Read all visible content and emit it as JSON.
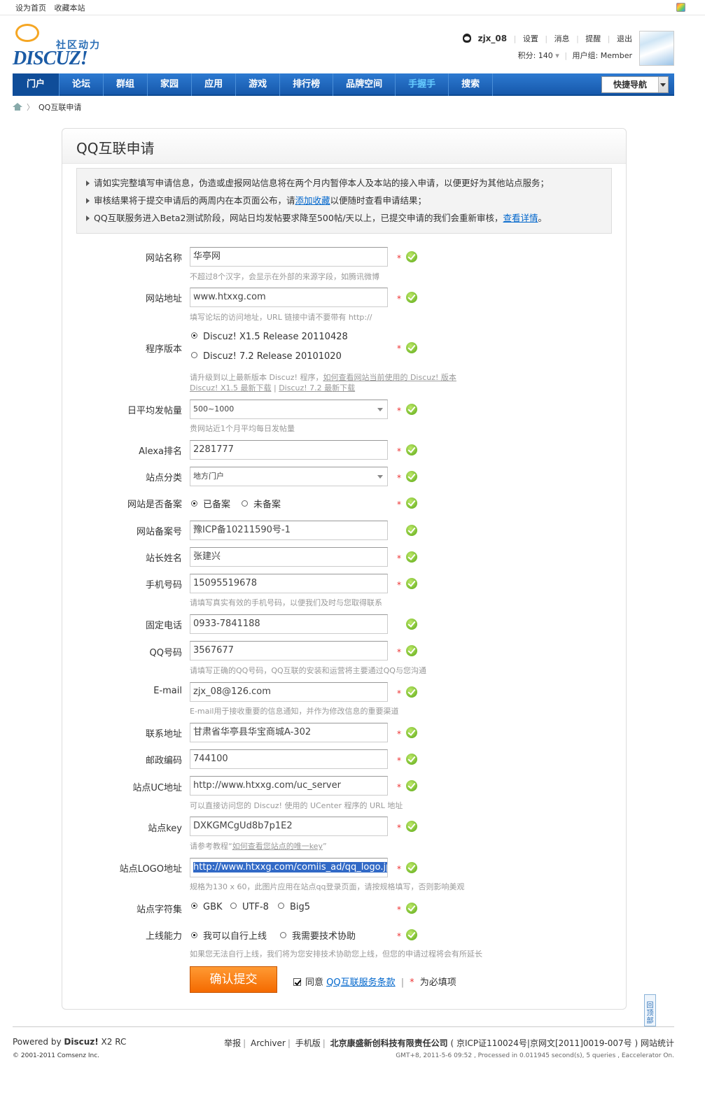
{
  "topbar": {
    "set_home": "设为首页",
    "bookmark": "收藏本站"
  },
  "logo": {
    "tagline": "社区动力",
    "word": "DISCUZ!"
  },
  "user": {
    "name": "zjx_08",
    "links": [
      "设置",
      "消息",
      "提醒",
      "退出"
    ],
    "credits": "积分: 140",
    "group": "用户组: Member"
  },
  "nav": {
    "items": [
      "门户",
      "论坛",
      "群组",
      "家园",
      "应用",
      "游戏",
      "排行榜",
      "品牌空间",
      "手握手",
      "搜索"
    ],
    "quick": "快捷导航"
  },
  "breadcrumb": {
    "current": "QQ互联申请"
  },
  "panel": {
    "title": "QQ互联申请"
  },
  "notice": {
    "line1": "请如实完整填写申请信息，伪造或虚报网站信息将在两个月内暂停本人及本站的接入申请，以便更好为其他站点服务；",
    "line2_a": "审核结果将于提交申请后的两周内在本页面公布，请",
    "line2_link": "添加收藏",
    "line2_b": "以便随时查看申请结果；",
    "line3_a": "QQ互联服务进入Beta2测试阶段，网站日均发帖要求降至500帖/天以上，已提交申请的我们会重新审核，",
    "line3_link": "查看详情",
    "line3_b": "。"
  },
  "form": {
    "site_name": {
      "label": "网站名称",
      "value": "华亭网",
      "tip": "不超过8个汉字，会显示在外部的来源字段，如腾讯微博"
    },
    "site_url": {
      "label": "网站地址",
      "value": "www.htxxg.com",
      "tip": "填写论坛的访问地址，URL 链接中请不要带有 http://"
    },
    "version": {
      "label": "程序版本",
      "opt1": "Discuz! X1.5 Release 20110428",
      "opt2": "Discuz! 7.2 Release 20101020",
      "tip_a": "请升级到以上最新版本 Discuz! 程序，",
      "tip_link1": "如何查看网站当前使用的 Discuz! 版本",
      "tip_link2": "Discuz! X1.5 最新下载",
      "tip_sep": " | ",
      "tip_link3": "Discuz! 7.2 最新下载"
    },
    "daily_posts": {
      "label": "日平均发帖量",
      "value": "500~1000",
      "tip": "贵网站近1个月平均每日发帖量"
    },
    "alexa": {
      "label": "Alexa排名",
      "value": "2281777"
    },
    "category": {
      "label": "站点分类",
      "value": "地方门户"
    },
    "filed": {
      "label": "网站是否备案",
      "opt1": "已备案",
      "opt2": "未备案"
    },
    "icp": {
      "label": "网站备案号",
      "value": "豫ICP备10211590号-1"
    },
    "owner": {
      "label": "站长姓名",
      "value": "张建兴"
    },
    "mobile": {
      "label": "手机号码",
      "value": "15095519678",
      "tip": "请填写真实有效的手机号码，以便我们及时与您取得联系"
    },
    "phone": {
      "label": "固定电话",
      "value": "0933-7841188"
    },
    "qq": {
      "label": "QQ号码",
      "value": "3567677",
      "tip": "请填写正确的QQ号码，QQ互联的安装和运营将主要通过QQ与您沟通"
    },
    "email": {
      "label": "E-mail",
      "value": "zjx_08@126.com",
      "tip": "E-mail用于接收重要的信息通知，并作为修改信息的重要渠道"
    },
    "address": {
      "label": "联系地址",
      "value": "甘肃省华亭县华宝商城A-302"
    },
    "zip": {
      "label": "邮政编码",
      "value": "744100"
    },
    "uc": {
      "label": "站点UC地址",
      "value": "http://www.htxxg.com/uc_server",
      "tip": "可以直接访问您的 Discuz! 使用的 UCenter 程序的 URL 地址"
    },
    "key": {
      "label": "站点key",
      "value": "DXKGMCgUd8b7p1E2",
      "tip_a": "请参考教程“",
      "tip_link": "如何查看您站点的唯一key",
      "tip_b": "”"
    },
    "logo": {
      "label": "站点LOGO地址",
      "value": "http://www.htxxg.com/comiis_ad/qq_logo.jpg",
      "tip": "规格为130 x 60，此图片应用在站点qq登录页面，请按规格填写，否则影响美观"
    },
    "charset": {
      "label": "站点字符集",
      "opt1": "GBK",
      "opt2": "UTF-8",
      "opt3": "Big5"
    },
    "online": {
      "label": "上线能力",
      "opt1": "我可以自行上线",
      "opt2": "我需要技术协助",
      "tip": "如果您无法自行上线，我们将为您安排技术协助您上线，但您的申请过程将会有所延长"
    },
    "required_mark": "*"
  },
  "submit": {
    "label": "确认提交"
  },
  "agree": {
    "text": "同意",
    "link": "QQ互联服务条款",
    "sep": "|",
    "star": "*",
    "required": "为必填项"
  },
  "totop": {
    "label": "回顶部"
  },
  "footer": {
    "powered_a": "Powered by ",
    "powered_b": "Discuz!",
    "powered_c": " X2 RC",
    "copy": "© 2001-2011 Comsenz Inc.",
    "links": [
      "举报",
      "Archiver",
      "手机版"
    ],
    "company": "北京康盛新创科技有限责任公司",
    "icp": "( 京ICP证110024号|京网文[2011]0019-007号 )",
    "stats": "网站统计",
    "gmt": "GMT+8, 2011-5-6 09:52 , Processed in 0.011945 second(s), 5 queries , Eaccelerator On."
  }
}
